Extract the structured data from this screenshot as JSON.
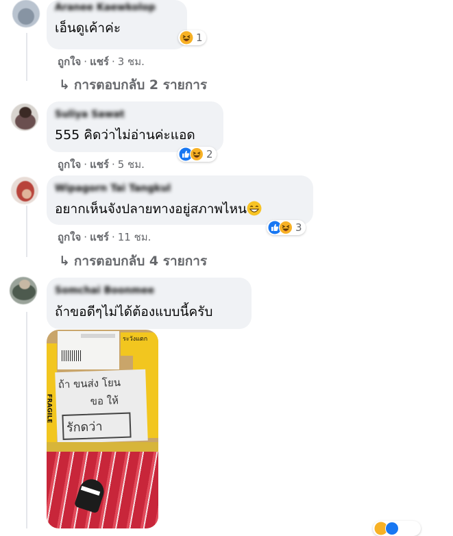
{
  "comments": [
    {
      "author": "Aranee Kaewkolop",
      "text": "เอ็นดูเค้าค่ะ",
      "reaction_count": "1",
      "like_label": "ถูกใจ",
      "share_label": "แชร์",
      "time": "3 ชม.",
      "replies_label": "การตอบกลับ 2 รายการ"
    },
    {
      "author": "Suliya Sawat",
      "text": "555 คิดว่าไม่อ่านค่ะแอด",
      "reaction_count": "2",
      "like_label": "ถูกใจ",
      "share_label": "แชร์",
      "time": "5 ชม."
    },
    {
      "author": "Wipagorn Tai Tangkul",
      "text": "อยากเห็นจังปลายทางอยู่สภาพไหน",
      "reaction_count": "3",
      "like_label": "ถูกใจ",
      "share_label": "แชร์",
      "time": "11 ชม.",
      "replies_label": "การตอบกลับ 4 รายการ"
    },
    {
      "author": "Somchai Boonmee",
      "text": "ถ้าขอดีๆไม่ได้ต้องแบบนี้ครับ",
      "photo_text": [
        "ถ้า ขนส่ง โยน",
        "ขอ ให้",
        "รักดว่า"
      ],
      "photo_label_side": "FRAGILE",
      "photo_label_top": "ระวังแตก"
    }
  ],
  "colors": {
    "bubble": "#f0f2f5",
    "meta_text": "#65676b",
    "like_blue": "#1877f2",
    "haha_yellow": "#f7b125"
  }
}
